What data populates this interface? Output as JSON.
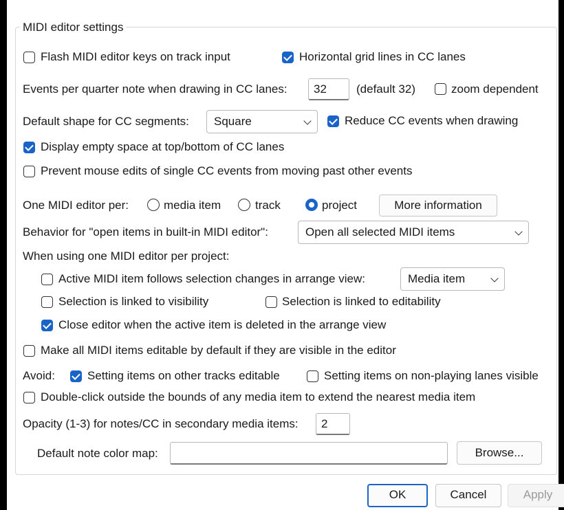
{
  "group_title": "MIDI editor settings",
  "flash_keys": {
    "label": "Flash MIDI editor keys on track input",
    "checked": false
  },
  "horizontal_grid": {
    "label": "Horizontal grid lines in CC lanes",
    "checked": true
  },
  "events_per_qn": {
    "label": "Events per quarter note when drawing in CC lanes:",
    "value": "32",
    "default_text": "(default 32)"
  },
  "zoom_dependent": {
    "label": "zoom dependent",
    "checked": false
  },
  "cc_shape": {
    "label": "Default shape for CC segments:",
    "selected": "Square"
  },
  "reduce_cc": {
    "label": "Reduce CC events when drawing",
    "checked": true
  },
  "display_empty": {
    "label": "Display empty space at top/bottom of CC lanes",
    "checked": true
  },
  "prevent_edits": {
    "label": "Prevent mouse edits of single CC events from moving past other events",
    "checked": false
  },
  "one_editor": {
    "label": "One MIDI editor per:",
    "options": [
      "media item",
      "track",
      "project"
    ],
    "selected": "project",
    "more_info_label": "More information"
  },
  "open_behavior": {
    "label": "Behavior for \"open items in built-in MIDI editor\":",
    "selected": "Open all selected MIDI items"
  },
  "per_project_heading": "When using one MIDI editor per project:",
  "active_follows": {
    "label": "Active MIDI item follows selection changes in arrange view:",
    "checked": false,
    "selected": "Media item"
  },
  "sel_visibility": {
    "label": "Selection is linked to visibility",
    "checked": false
  },
  "sel_editability": {
    "label": "Selection is linked to editability",
    "checked": false
  },
  "close_editor": {
    "label": "Close editor when the active item is deleted in the arrange view",
    "checked": true
  },
  "make_editable": {
    "label": "Make all MIDI items editable by default if they are visible in the editor",
    "checked": false
  },
  "avoid": {
    "label": "Avoid:",
    "other_tracks": {
      "label": "Setting items on other tracks editable",
      "checked": true
    },
    "non_playing": {
      "label": "Setting items on non-playing lanes visible",
      "checked": false
    }
  },
  "double_click": {
    "label": "Double-click outside the bounds of any media item to extend the nearest media item",
    "checked": false
  },
  "opacity": {
    "label": "Opacity (1-3) for notes/CC in secondary media items:",
    "value": "2"
  },
  "note_color": {
    "label": "Default note color map:",
    "value": "",
    "browse_label": "Browse..."
  },
  "buttons": {
    "ok": "OK",
    "cancel": "Cancel",
    "apply": "Apply"
  }
}
